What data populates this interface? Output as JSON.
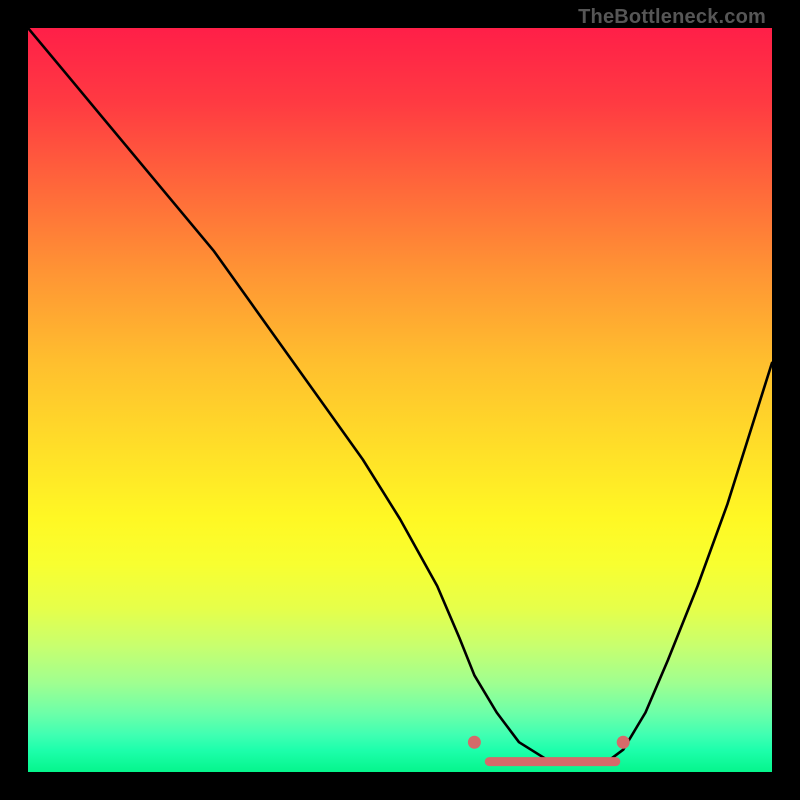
{
  "watermark": "TheBottleneck.com",
  "colors": {
    "page_bg": "#000000",
    "gradient_top": "#ff1f48",
    "gradient_bottom": "#05f58c",
    "curve": "#000000",
    "marker": "#d56a6a"
  },
  "chart_data": {
    "type": "line",
    "title": "",
    "xlabel": "",
    "ylabel": "",
    "xlim": [
      0,
      100
    ],
    "ylim": [
      0,
      100
    ],
    "grid": false,
    "legend": false,
    "annotations": [],
    "series": [
      {
        "name": "bottleneck-curve",
        "x": [
          0,
          5,
          10,
          15,
          20,
          25,
          30,
          35,
          40,
          45,
          50,
          55,
          58,
          60,
          63,
          66,
          70,
          74,
          78,
          80,
          83,
          86,
          90,
          94,
          100
        ],
        "values": [
          100,
          94,
          88,
          82,
          76,
          70,
          63,
          56,
          49,
          42,
          34,
          25,
          18,
          13,
          8,
          4,
          1.5,
          1.2,
          1.5,
          3,
          8,
          15,
          25,
          36,
          55
        ]
      }
    ],
    "markers": [
      {
        "name": "flat-segment-left-cap",
        "x": 60,
        "y": 4
      },
      {
        "name": "flat-segment-right-cap",
        "x": 80,
        "y": 4
      }
    ],
    "flat_segment": {
      "x_start": 62,
      "x_end": 79,
      "y": 1.4
    }
  }
}
